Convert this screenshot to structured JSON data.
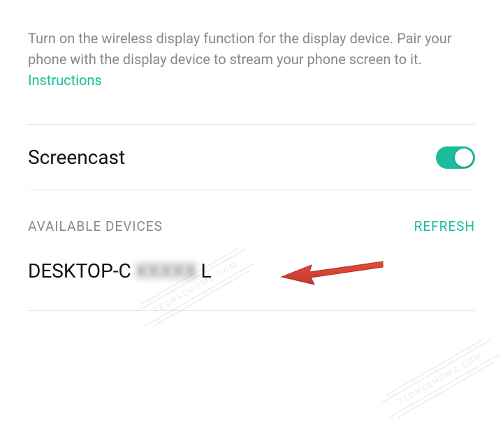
{
  "description": {
    "text": "Turn on the wireless display function for the display device. Pair your phone with the display device to stream your phone screen to it.",
    "link_label": "Instructions"
  },
  "screencast": {
    "title": "Screencast",
    "enabled": true
  },
  "devices": {
    "section_label": "AVAILABLE DEVICES",
    "refresh_label": "REFRESH",
    "items": [
      {
        "name_visible_prefix": "DESKTOP-C",
        "name_obscured": "XXXXX",
        "name_visible_suffix": "L"
      }
    ]
  },
  "colors": {
    "accent": "#1abc9c",
    "muted": "#888"
  }
}
